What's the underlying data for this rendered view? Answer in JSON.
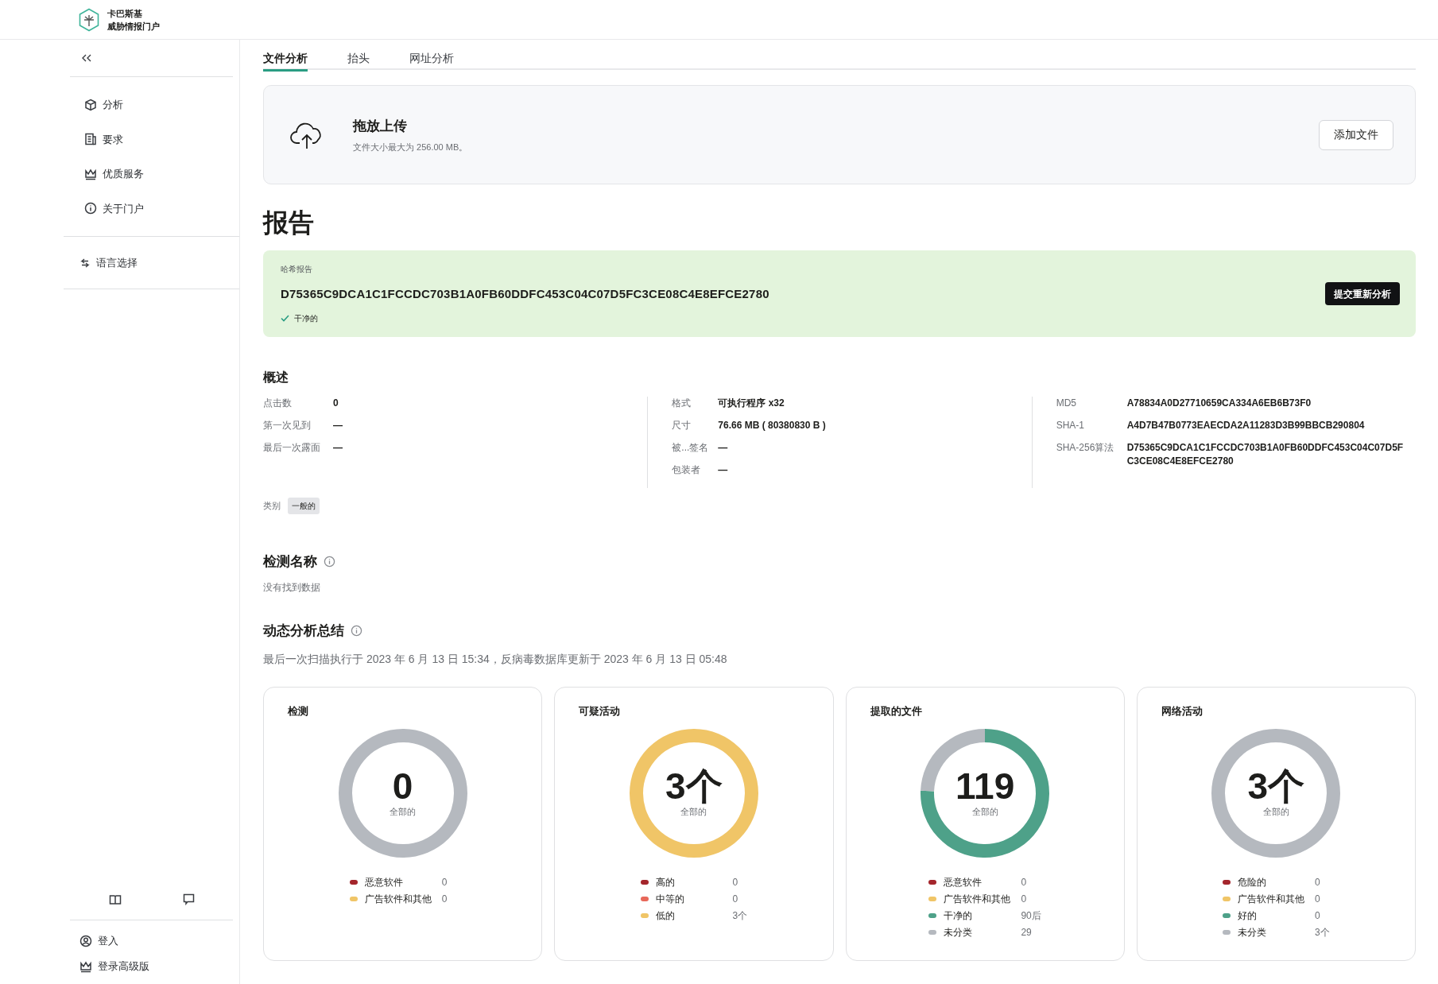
{
  "brand": {
    "line1": "卡巴斯基",
    "line2": "威胁情报门户"
  },
  "sidebar": {
    "items": [
      {
        "label": "分析"
      },
      {
        "label": "要求"
      },
      {
        "label": "优质服务"
      },
      {
        "label": "关于门户"
      }
    ],
    "language": "语言选择",
    "footer": [
      {
        "label": "登入"
      },
      {
        "label": "登录高级版"
      }
    ]
  },
  "tabs": [
    {
      "label": "文件分析",
      "selected": true
    },
    {
      "label": "抬头",
      "selected": false
    },
    {
      "label": "网址分析",
      "selected": false
    }
  ],
  "upload": {
    "title": "拖放上传",
    "hint": "文件大小最大为 256.00 MB。",
    "button": "添加文件"
  },
  "report": {
    "title": "报告",
    "hash": {
      "caption": "哈希报告",
      "value": "D75365C9DCA1C1FCCDC703B1A0FB60DDFC453C04C07D5FC3CE08C4E8EFCE2780",
      "status": "干净的",
      "button": "提交重新分析"
    },
    "overview": {
      "title": "概述",
      "columns": [
        [
          {
            "label": "点击数",
            "value": "0"
          },
          {
            "label": "第一次见到",
            "value": "—"
          },
          {
            "label": "最后一次露面",
            "value": "—"
          }
        ],
        [
          {
            "label": "格式",
            "value": "可执行程序 x32"
          },
          {
            "label": "尺寸",
            "value": "76.66 MB ( 80380830 B )"
          },
          {
            "label": "被...签名",
            "value": "—"
          },
          {
            "label": "包装者",
            "value": "—"
          }
        ],
        [
          {
            "label": "MD5",
            "value": "A78834A0D27710659CA334A6EB6B73F0"
          },
          {
            "label": "SHA-1",
            "value": "A4D7B47B0773EAECDA2A11283D3B99BBCB290804"
          },
          {
            "label": "SHA-256算法",
            "value": "D75365C9DCA1C1FCCDC703B1A0FB60DDFC453C04C07D5FC3CE08C4E8EFCE2780"
          }
        ]
      ],
      "category_label": "类别",
      "category": "一般的"
    },
    "detections": {
      "title": "检测名称",
      "empty": "没有找到数据"
    },
    "dynamic": {
      "title": "动态分析总结",
      "note": "最后一次扫描执行于 2023 年 6 月 13 日 15:34，反病毒数据库更新于 2023 年 6 月 13 日 05:48",
      "cards": [
        {
          "title": "检测",
          "total": "0",
          "total_label": "全部的",
          "legend": [
            {
              "label": "恶意软件",
              "value": "0",
              "color": "#a4262c"
            },
            {
              "label": "广告软件和其他",
              "value": "0",
              "color": "#f0c567"
            }
          ]
        },
        {
          "title": "可疑活动",
          "total": "3个",
          "total_label": "全部的",
          "legend": [
            {
              "label": "高的",
              "value": "0",
              "color": "#a4262c"
            },
            {
              "label": "中等的",
              "value": "0",
              "color": "#e8685a"
            },
            {
              "label": "低的",
              "value": "3个",
              "color": "#f0c567"
            }
          ]
        },
        {
          "title": "提取的文件",
          "total": "119",
          "total_label": "全部的",
          "legend": [
            {
              "label": "恶意软件",
              "value": "0",
              "color": "#a4262c"
            },
            {
              "label": "广告软件和其他",
              "value": "0",
              "color": "#f0c567"
            },
            {
              "label": "干净的",
              "value": "90后",
              "color": "#4ea189"
            },
            {
              "label": "未分类",
              "value": "29",
              "color": "#b5b9bf"
            }
          ]
        },
        {
          "title": "网络活动",
          "total": "3个",
          "total_label": "全部的",
          "legend": [
            {
              "label": "危险的",
              "value": "0",
              "color": "#a4262c"
            },
            {
              "label": "广告软件和其他",
              "value": "0",
              "color": "#f0c567"
            },
            {
              "label": "好的",
              "value": "0",
              "color": "#4ea189"
            },
            {
              "label": "未分类",
              "value": "3个",
              "color": "#b5b9bf"
            }
          ]
        }
      ]
    }
  }
}
